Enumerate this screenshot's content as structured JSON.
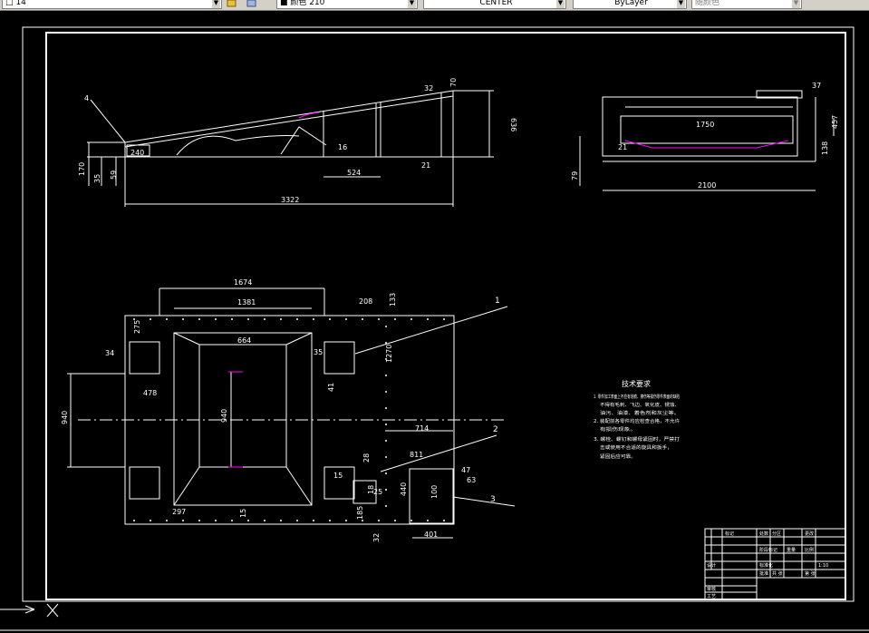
{
  "toolbar": {
    "layer_value": "□ 14",
    "color_value": "■ 颜色 210",
    "linetype_value": "CENTER",
    "lineweight_value": "ByLayer",
    "plotstyle_value": "随颜色"
  },
  "drawing": {
    "side_view": {
      "dims": [
        "4",
        "32",
        "70",
        "636",
        "240",
        "16",
        "524",
        "21",
        "170",
        "35",
        "59",
        "3322"
      ]
    },
    "end_view": {
      "dims": [
        "37",
        "1750",
        "457",
        "21",
        "79",
        "138",
        "2100"
      ]
    },
    "plan_view": {
      "dims": [
        "1674",
        "1381",
        "208",
        "133",
        "275",
        "34",
        "664",
        "35",
        "41",
        "1270",
        "478",
        "940",
        "940",
        "714",
        "811",
        "15",
        "28",
        "47",
        "63",
        "440",
        "100",
        "297",
        "15",
        "18",
        "185",
        "32",
        "401",
        "25"
      ],
      "callouts": [
        "1",
        "2",
        "3"
      ]
    },
    "notes": {
      "title": "技术要求",
      "lines": [
        "1. 零件加工表面上不应有划痕、擦伤等损伤零件表面的缺陷",
        "不得有毛刺、飞边、氧化皮、锈蚀、",
        "油污、油漆、着色剂和灰尘等。",
        "2. 装配前各零件均应检查合格，不允许",
        "有损伤现象。",
        "3. 螺栓、螺钉和螺母紧固时，严禁打",
        "击或使用不合适的旋具和扳手，",
        "紧固后应可靠。"
      ]
    },
    "title_block": {
      "rows": [
        [
          "标记",
          "处数",
          "分区",
          "更改"
        ],
        [
          "设计",
          "",
          "标准化",
          ""
        ],
        [
          "审核",
          "",
          "",
          ""
        ],
        [
          "工艺",
          "",
          "批准",
          ""
        ]
      ],
      "cells": [
        "阶段标记",
        "重量",
        "比例",
        "1:10",
        "共 张",
        "第 张"
      ]
    }
  }
}
